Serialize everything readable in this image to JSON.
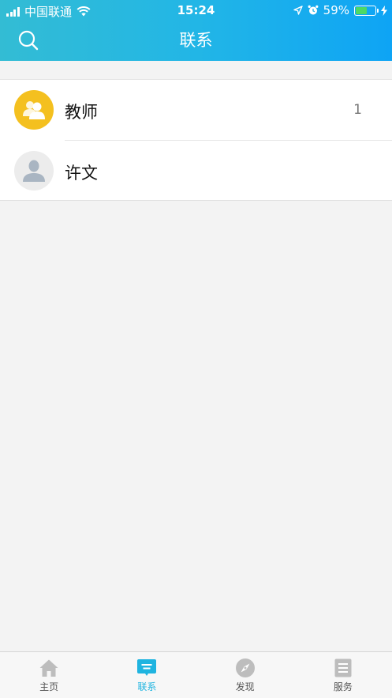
{
  "status_bar": {
    "carrier": "中国联通",
    "time": "15:24",
    "battery": "59%",
    "battery_level": 0.59
  },
  "header": {
    "title": "联系",
    "search_icon": "search-icon"
  },
  "contacts": [
    {
      "label": "教师",
      "count": "1",
      "icon": "group-icon",
      "avatar_color": "#f4c01f"
    },
    {
      "label": "许文",
      "count": "",
      "icon": "person-icon",
      "avatar_color": "#ececec"
    }
  ],
  "tabs": [
    {
      "label": "主页",
      "icon": "home-icon",
      "active": false
    },
    {
      "label": "联系",
      "icon": "chat-icon",
      "active": true
    },
    {
      "label": "发现",
      "icon": "compass-icon",
      "active": false
    },
    {
      "label": "服务",
      "icon": "document-icon",
      "active": false
    }
  ],
  "colors": {
    "accent": "#1fb4e0",
    "header_start": "#33bcd4",
    "header_end": "#0ea4f5"
  }
}
